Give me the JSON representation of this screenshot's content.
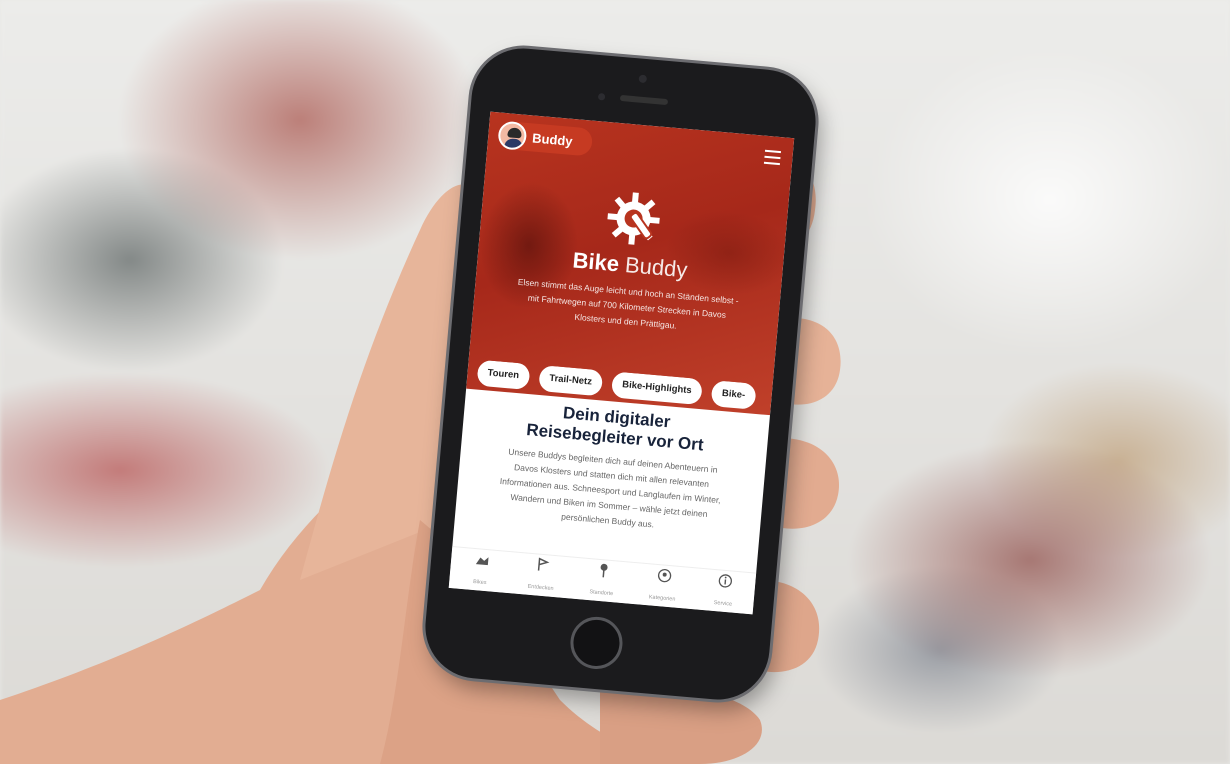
{
  "app": {
    "brand": "Buddy",
    "hero_title_bold": "Bike",
    "hero_title_light": "Buddy",
    "hero_text": "Elsen stimmt das Auge leicht und hoch an Ständen selbst - mit Fahrtwegen auf 700 Kilometer Strecken in Davos Klosters und den Prättigau.",
    "chips": [
      "Touren",
      "Trail-Netz",
      "Bike-Highlights",
      "Bike-"
    ],
    "section_title_line1": "Dein digitaler",
    "section_title_line2": "Reisebegleiter vor Ort",
    "section_text": "Unsere Buddys begleiten dich auf deinen Abenteuern in Davos Klosters und statten dich mit allen relevanten Informationen aus. Schneesport und Langlaufen im Winter, Wandern und Biken im Sommer – wähle jetzt deinen persönlichen Buddy aus.",
    "tabs": [
      {
        "label": "Bikes",
        "icon": "bike-icon"
      },
      {
        "label": "Entdecken",
        "icon": "route-icon"
      },
      {
        "label": "Standorte",
        "icon": "map-pin-icon"
      },
      {
        "label": "Kategorien",
        "icon": "category-icon"
      },
      {
        "label": "Service",
        "icon": "info-icon"
      }
    ]
  },
  "colors": {
    "hero_red": "#b8341f",
    "navy": "#18233a",
    "phone_body": "#1b1b1d"
  }
}
